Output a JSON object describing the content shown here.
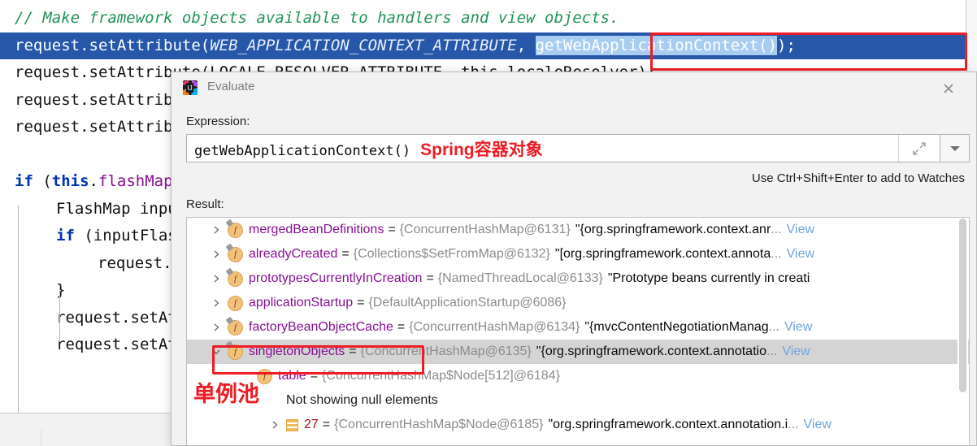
{
  "editor": {
    "lines": [
      {
        "indent": 0,
        "segments": [
          {
            "style": "cmt",
            "text": "// Make framework objects available to handlers and view objects."
          }
        ]
      },
      {
        "indent": 0,
        "selected": true,
        "segments": [
          {
            "style": "plain",
            "text": "request.setAttribute("
          },
          {
            "style": "static",
            "text": "WEB_APPLICATION_CONTEXT_ATTRIBUTE"
          },
          {
            "style": "plain",
            "text": ", "
          },
          {
            "style": "codesel",
            "text": "getWebApplicationContext()"
          },
          {
            "style": "plain",
            "text": ");"
          }
        ]
      },
      {
        "indent": 0,
        "segments": [
          {
            "style": "plain",
            "text": "request.setAttribute(LOCALE_RESOLVER_ATTRIBUTE, this.localeResolver);"
          }
        ]
      },
      {
        "indent": 0,
        "segments": [
          {
            "style": "plain",
            "text": "request.setAttribute(THEME_RESOLVER_ATTRIBUTE, this.themeResolver);"
          }
        ]
      },
      {
        "indent": 0,
        "segments": [
          {
            "style": "plain",
            "text": "request.setAttribute(THEME_SOURCE_ATTRIBUTE, getThemeSource());"
          }
        ]
      },
      {
        "indent": 0,
        "segments": [
          {
            "style": "plain",
            "text": ""
          }
        ]
      },
      {
        "indent": 0,
        "segments": [
          {
            "style": "kw",
            "text": "if "
          },
          {
            "style": "plain",
            "text": "("
          },
          {
            "style": "kw",
            "text": "this"
          },
          {
            "style": "plain",
            "text": "."
          },
          {
            "style": "field",
            "text": "flashMapManager"
          },
          {
            "style": "plain",
            "text": " != null) {"
          }
        ]
      },
      {
        "indent": 1,
        "segments": [
          {
            "style": "plain",
            "text": "FlashMap inputFlashMap = this.flashMapManager.retrieveAndUpdate(request, response);"
          }
        ]
      },
      {
        "indent": 1,
        "segments": [
          {
            "style": "kw",
            "text": "if "
          },
          {
            "style": "plain",
            "text": "(inputFlashMap != null) {"
          }
        ]
      },
      {
        "indent": 2,
        "segments": [
          {
            "style": "plain",
            "text": "request.setAttribute(INPUT_FLASH_MAP_ATTRIBUTE, Collections.unmodifiableMap(inputFlashMap));"
          }
        ]
      },
      {
        "indent": 1,
        "segments": [
          {
            "style": "plain",
            "text": "}"
          }
        ]
      },
      {
        "indent": 1,
        "segments": [
          {
            "style": "plain",
            "text": "request.setAttribute(OUTPUT_FLASH_MAP_ATTRIBUTE, new FlashMap());"
          }
        ]
      },
      {
        "indent": 1,
        "segments": [
          {
            "style": "plain",
            "text": "request.setAttribute(FLASH_MAP_MANAGER_ATTRIBUTE, this.flashMapManager);"
          }
        ]
      }
    ]
  },
  "annotations": {
    "code_box_label": "getWebApplicationContext()",
    "expression_note": "Spring容器对象",
    "singleton_note": "单例池"
  },
  "dialog": {
    "title": "Evaluate",
    "icon": "intellij-idea-icon",
    "close_icon": "close-icon",
    "expression_label": "Expression:",
    "expression_value": "getWebApplicationContext()",
    "expand_icon": "expand-icon",
    "dropdown_icon": "chevron-down-icon",
    "hint": "Use Ctrl+Shift+Enter to add to Watches",
    "result_label": "Result:",
    "tree": [
      {
        "indent": 0,
        "expander": "right",
        "icon": "field-icon",
        "private": true,
        "name": "mergedBeanDefinitions",
        "eq": "=",
        "type": "{ConcurrentHashMap@6131}",
        "value": "\"{org.springframework.context.anr",
        "ellipsis": "...",
        "view": "View",
        "selected": false
      },
      {
        "indent": 0,
        "expander": "right",
        "icon": "field-icon",
        "private": true,
        "name": "alreadyCreated",
        "eq": "=",
        "type": "{Collections$SetFromMap@6132}",
        "value": "\"[org.springframework.context.annota",
        "ellipsis": "...",
        "view": "View",
        "selected": false
      },
      {
        "indent": 0,
        "expander": "right",
        "icon": "field-icon",
        "private": true,
        "name": "prototypesCurrentlyInCreation",
        "eq": "=",
        "type": "{NamedThreadLocal@6133}",
        "value": "\"Prototype beans currently in creati",
        "ellipsis": "",
        "view": "",
        "selected": false
      },
      {
        "indent": 0,
        "expander": "right",
        "icon": "field-icon",
        "private": false,
        "name": "applicationStartup",
        "eq": "=",
        "type": "{DefaultApplicationStartup@6086}",
        "value": "",
        "ellipsis": "",
        "view": "",
        "selected": false
      },
      {
        "indent": 0,
        "expander": "right",
        "icon": "field-icon",
        "private": true,
        "name": "factoryBeanObjectCache",
        "eq": "=",
        "type": "{ConcurrentHashMap@6134}",
        "value": "\"{mvcContentNegotiationManag",
        "ellipsis": "...",
        "view": "View",
        "selected": false
      },
      {
        "indent": 0,
        "expander": "down",
        "icon": "field-icon",
        "private": true,
        "name": "singletonObjects",
        "eq": "=",
        "type": "{ConcurrentHashMap@6135}",
        "value": "\"{org.springframework.context.annotatio",
        "ellipsis": "...",
        "view": "View",
        "selected": true
      },
      {
        "indent": 1,
        "expander": "none",
        "icon": "field-icon",
        "private": false,
        "name": "table",
        "eq": "=",
        "type": "{ConcurrentHashMap$Node[512]@6184}",
        "value": "",
        "ellipsis": "",
        "view": "",
        "selected": false
      },
      {
        "indent": 2,
        "expander": "none",
        "icon": "none",
        "private": false,
        "name": "",
        "eq": "",
        "type": "",
        "plain": "Not showing null elements",
        "value": "",
        "ellipsis": "",
        "view": "",
        "selected": false
      },
      {
        "indent": 2,
        "expander": "right",
        "icon": "array-icon",
        "private": false,
        "name": "27",
        "numeric": true,
        "eq": "=",
        "type": "{ConcurrentHashMap$Node@6185}",
        "value": "\"org.springframework.context.annotation.i",
        "ellipsis": "...",
        "view": "View",
        "selected": false
      }
    ]
  },
  "colors": {
    "accent_red": "#ee1c25",
    "selection_blue": "#2657a8",
    "code_selection": "#a8cdf0",
    "comment_green": "#219358",
    "keyword_blue": "#0033b3",
    "field_purple": "#871094"
  }
}
